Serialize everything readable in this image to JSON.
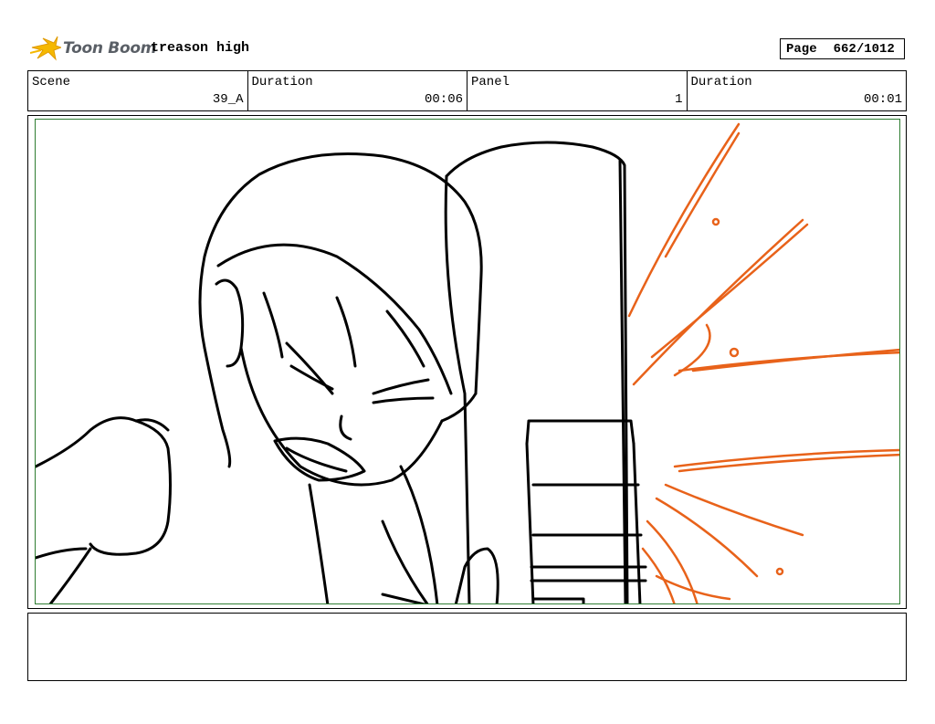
{
  "header": {
    "logo_text": "Toon Boom",
    "project_title": "treason high",
    "page_label": "Page",
    "page_value": "662/1012"
  },
  "info": {
    "scene_label": "Scene",
    "scene_value": "39_A",
    "duration_label": "Duration",
    "duration_value": "00:06",
    "panel_label": "Panel",
    "panel_value": "1",
    "panel_duration_label": "Duration",
    "panel_duration_value": "00:01"
  },
  "colors": {
    "frame_border": "#2e7d32",
    "impact_lines": "#e8621a",
    "logo_star": "#f5b800"
  }
}
